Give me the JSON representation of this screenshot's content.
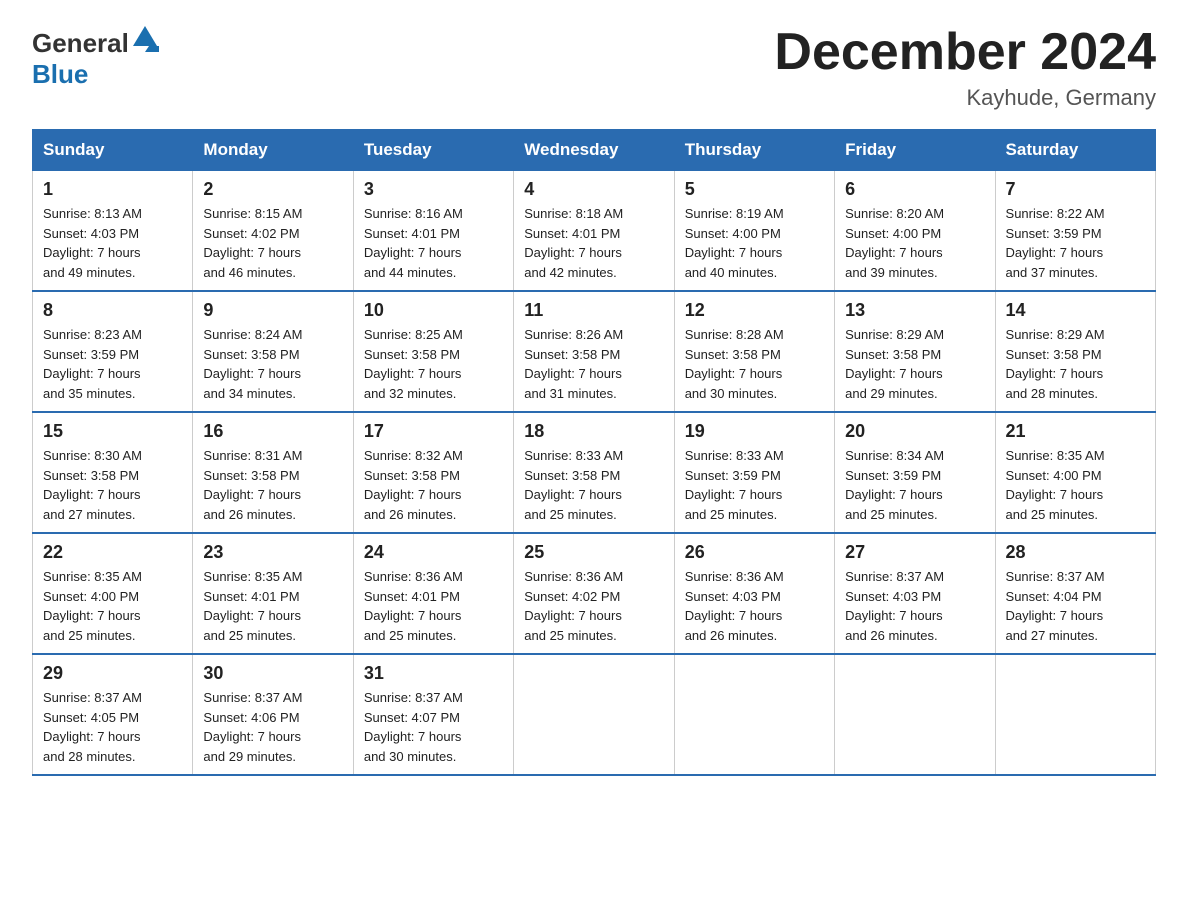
{
  "header": {
    "title": "December 2024",
    "subtitle": "Kayhude, Germany",
    "logo_general": "General",
    "logo_blue": "Blue"
  },
  "days_of_week": [
    "Sunday",
    "Monday",
    "Tuesday",
    "Wednesday",
    "Thursday",
    "Friday",
    "Saturday"
  ],
  "weeks": [
    [
      {
        "day": "1",
        "sunrise": "8:13 AM",
        "sunset": "4:03 PM",
        "daylight": "7 hours and 49 minutes."
      },
      {
        "day": "2",
        "sunrise": "8:15 AM",
        "sunset": "4:02 PM",
        "daylight": "7 hours and 46 minutes."
      },
      {
        "day": "3",
        "sunrise": "8:16 AM",
        "sunset": "4:01 PM",
        "daylight": "7 hours and 44 minutes."
      },
      {
        "day": "4",
        "sunrise": "8:18 AM",
        "sunset": "4:01 PM",
        "daylight": "7 hours and 42 minutes."
      },
      {
        "day": "5",
        "sunrise": "8:19 AM",
        "sunset": "4:00 PM",
        "daylight": "7 hours and 40 minutes."
      },
      {
        "day": "6",
        "sunrise": "8:20 AM",
        "sunset": "4:00 PM",
        "daylight": "7 hours and 39 minutes."
      },
      {
        "day": "7",
        "sunrise": "8:22 AM",
        "sunset": "3:59 PM",
        "daylight": "7 hours and 37 minutes."
      }
    ],
    [
      {
        "day": "8",
        "sunrise": "8:23 AM",
        "sunset": "3:59 PM",
        "daylight": "7 hours and 35 minutes."
      },
      {
        "day": "9",
        "sunrise": "8:24 AM",
        "sunset": "3:58 PM",
        "daylight": "7 hours and 34 minutes."
      },
      {
        "day": "10",
        "sunrise": "8:25 AM",
        "sunset": "3:58 PM",
        "daylight": "7 hours and 32 minutes."
      },
      {
        "day": "11",
        "sunrise": "8:26 AM",
        "sunset": "3:58 PM",
        "daylight": "7 hours and 31 minutes."
      },
      {
        "day": "12",
        "sunrise": "8:28 AM",
        "sunset": "3:58 PM",
        "daylight": "7 hours and 30 minutes."
      },
      {
        "day": "13",
        "sunrise": "8:29 AM",
        "sunset": "3:58 PM",
        "daylight": "7 hours and 29 minutes."
      },
      {
        "day": "14",
        "sunrise": "8:29 AM",
        "sunset": "3:58 PM",
        "daylight": "7 hours and 28 minutes."
      }
    ],
    [
      {
        "day": "15",
        "sunrise": "8:30 AM",
        "sunset": "3:58 PM",
        "daylight": "7 hours and 27 minutes."
      },
      {
        "day": "16",
        "sunrise": "8:31 AM",
        "sunset": "3:58 PM",
        "daylight": "7 hours and 26 minutes."
      },
      {
        "day": "17",
        "sunrise": "8:32 AM",
        "sunset": "3:58 PM",
        "daylight": "7 hours and 26 minutes."
      },
      {
        "day": "18",
        "sunrise": "8:33 AM",
        "sunset": "3:58 PM",
        "daylight": "7 hours and 25 minutes."
      },
      {
        "day": "19",
        "sunrise": "8:33 AM",
        "sunset": "3:59 PM",
        "daylight": "7 hours and 25 minutes."
      },
      {
        "day": "20",
        "sunrise": "8:34 AM",
        "sunset": "3:59 PM",
        "daylight": "7 hours and 25 minutes."
      },
      {
        "day": "21",
        "sunrise": "8:35 AM",
        "sunset": "4:00 PM",
        "daylight": "7 hours and 25 minutes."
      }
    ],
    [
      {
        "day": "22",
        "sunrise": "8:35 AM",
        "sunset": "4:00 PM",
        "daylight": "7 hours and 25 minutes."
      },
      {
        "day": "23",
        "sunrise": "8:35 AM",
        "sunset": "4:01 PM",
        "daylight": "7 hours and 25 minutes."
      },
      {
        "day": "24",
        "sunrise": "8:36 AM",
        "sunset": "4:01 PM",
        "daylight": "7 hours and 25 minutes."
      },
      {
        "day": "25",
        "sunrise": "8:36 AM",
        "sunset": "4:02 PM",
        "daylight": "7 hours and 25 minutes."
      },
      {
        "day": "26",
        "sunrise": "8:36 AM",
        "sunset": "4:03 PM",
        "daylight": "7 hours and 26 minutes."
      },
      {
        "day": "27",
        "sunrise": "8:37 AM",
        "sunset": "4:03 PM",
        "daylight": "7 hours and 26 minutes."
      },
      {
        "day": "28",
        "sunrise": "8:37 AM",
        "sunset": "4:04 PM",
        "daylight": "7 hours and 27 minutes."
      }
    ],
    [
      {
        "day": "29",
        "sunrise": "8:37 AM",
        "sunset": "4:05 PM",
        "daylight": "7 hours and 28 minutes."
      },
      {
        "day": "30",
        "sunrise": "8:37 AM",
        "sunset": "4:06 PM",
        "daylight": "7 hours and 29 minutes."
      },
      {
        "day": "31",
        "sunrise": "8:37 AM",
        "sunset": "4:07 PM",
        "daylight": "7 hours and 30 minutes."
      },
      null,
      null,
      null,
      null
    ]
  ],
  "labels": {
    "sunrise": "Sunrise:",
    "sunset": "Sunset:",
    "daylight": "Daylight:"
  }
}
